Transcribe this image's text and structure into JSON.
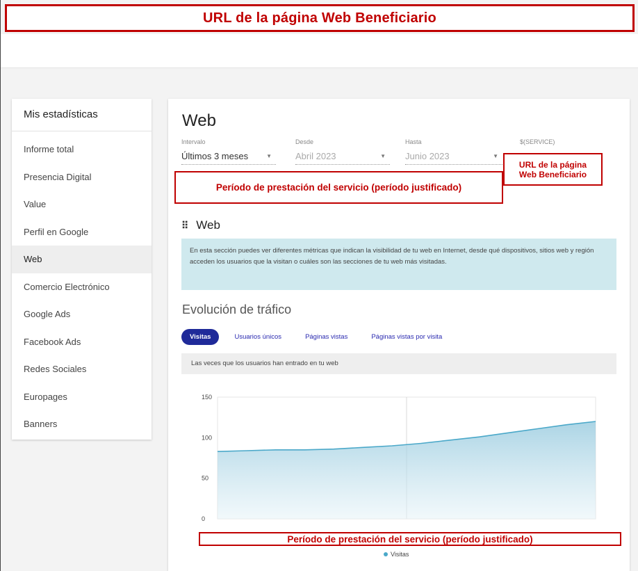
{
  "annotations": {
    "top_banner": "URL de la página Web Beneficiario",
    "url_box": "URL de la página Web Beneficiario",
    "period_box_top": "Período de prestación del servicio (período justificado)",
    "period_box_bottom": "Período de prestación del servicio (período justificado)"
  },
  "sidebar": {
    "title": "Mis estadísticas",
    "items": [
      {
        "label": "Informe total"
      },
      {
        "label": "Presencia Digital"
      },
      {
        "label": "Value"
      },
      {
        "label": "Perfil en Google"
      },
      {
        "label": "Web",
        "active": true
      },
      {
        "label": "Comercio Electrónico"
      },
      {
        "label": "Google Ads"
      },
      {
        "label": "Facebook Ads"
      },
      {
        "label": "Redes Sociales"
      },
      {
        "label": "Europages"
      },
      {
        "label": "Banners"
      }
    ]
  },
  "main": {
    "title": "Web",
    "filters": {
      "interval": {
        "label": "Intervalo",
        "value": "Últimos 3 meses"
      },
      "from": {
        "label": "Desde",
        "value": "Abril 2023"
      },
      "to": {
        "label": "Hasta",
        "value": "Junio 2023"
      },
      "service": {
        "label": "$(SERVICE)"
      }
    },
    "section_title": "Web",
    "info_text": "En esta sección puedes ver diferentes métricas que indican la visibilidad de tu web en Internet, desde qué dispositivos, sitios web y región acceden los usuarios que la visitan o cuáles son las secciones de tu web más visitadas.",
    "traffic_title": "Evolución de tráfico",
    "tabs": [
      {
        "label": "Visitas",
        "active": true
      },
      {
        "label": "Usuarios únicos"
      },
      {
        "label": "Páginas vistas"
      },
      {
        "label": "Páginas vistas por visita"
      }
    ],
    "chart_subtitle": "Las veces que los usuarios han entrado en tu web"
  },
  "colors": {
    "annotation_red": "#c00000",
    "tab_active": "#1f2a99",
    "info_bg": "#cfe9ee",
    "series_line": "#4aa8c9"
  },
  "chart_data": {
    "type": "area",
    "y_ticks": [
      "150",
      "100",
      "50",
      "0"
    ],
    "ylim": [
      0,
      150
    ],
    "series": [
      {
        "name": "Visitas",
        "values": [
          83,
          84,
          85,
          85,
          86,
          88,
          90,
          93,
          97,
          101,
          106,
          111,
          116,
          120
        ]
      }
    ],
    "legend": "bottom-center"
  }
}
